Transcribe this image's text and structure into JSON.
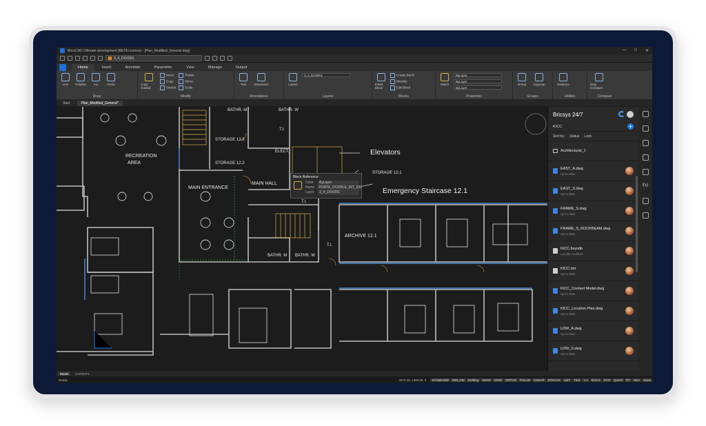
{
  "app": {
    "title": "BricsCAD Ultimate development (BETA License) - [Plan_Modified_General.dwg]",
    "window_controls": [
      "—",
      "□",
      "✕"
    ]
  },
  "quick_access": {
    "layer_value": "3_4_DOORS"
  },
  "ribbon_tabs": [
    "Home",
    "Insert",
    "Annotate",
    "Parametric",
    "View",
    "Manage",
    "Output"
  ],
  "ribbon": {
    "draw": {
      "caption": "Draw",
      "tools": [
        "Line",
        "Polyline",
        "Arc",
        "Circle"
      ]
    },
    "modify": {
      "caption": "Modify",
      "copy_guided": "Copy Guided",
      "items": [
        "Move",
        "Copy",
        "Stretch",
        "Rotate",
        "Mirror",
        "Scale"
      ]
    },
    "annotations": {
      "caption": "Annotations",
      "tools": [
        "Text",
        "Dimension"
      ]
    },
    "layers": {
      "caption": "Layers",
      "layers_button": "Layers",
      "current": "3_4_DOORS"
    },
    "blocks": {
      "caption": "Blocks",
      "insert": "Insert Block",
      "items": [
        "Create Block",
        "Blockify",
        "Edit Block"
      ]
    },
    "properties": {
      "caption": "Properties",
      "match": "Match",
      "values": [
        "ByLayer",
        "ByLayer",
        "ByLayer"
      ]
    },
    "groups": {
      "caption": "Groups",
      "tools": [
        "Group",
        "Ungroup"
      ]
    },
    "utilities": {
      "caption": "Utilities",
      "tools": [
        "Distance"
      ]
    },
    "compare": {
      "caption": "Compare",
      "tools": [
        "Dwg Compare"
      ]
    }
  },
  "doc_tabs": [
    "Start",
    "Plan_Modified_General*"
  ],
  "drawing_labels": {
    "bathr_m_top": "BATHR. M",
    "bathr_w_top": "BATHR. W",
    "storage_123": "STORAGE 12.3",
    "storage_122": "STORAGE 12.2",
    "elect": "ELECT.",
    "ti_1": "T.I.",
    "ti_2": "T.I.",
    "ti_3": "T.I.",
    "recreation": "RECREATION",
    "recreation_2": "AREA",
    "main_entrance": "MAIN ENTRANCE",
    "main_hall": "MAIN HALL",
    "storage_121": "STORAGE 12.1",
    "elevators": "Elevators",
    "emergency": "Emergency Staircase 12.1",
    "archive": "ARCHIVE 12.1",
    "bathr_m_bottom": "BATHR. M",
    "bathr_w_bottom": "BATHR. W"
  },
  "block_reference": {
    "title": "Block Reference",
    "rows": [
      {
        "key": "Color",
        "value": "ByLayer"
      },
      {
        "key": "Name",
        "value": "PORTE_DOUBLE_INT_200"
      },
      {
        "key": "Layer",
        "value": "3_4_DOORS"
      }
    ]
  },
  "bricsys_panel": {
    "title": "Bricsys 24/7",
    "breadcrumb": "KICC",
    "sort_label": "Sort by:",
    "sort_options": [
      "Status",
      "Lock"
    ],
    "items": [
      {
        "name": "Architectural_1",
        "status": "",
        "kind": "folder"
      },
      {
        "name": "EAST_A.dwg",
        "status": "Up-to-date",
        "kind": "dwg"
      },
      {
        "name": "EAST_S.dwg",
        "status": "Up-to-date",
        "kind": "dwg"
      },
      {
        "name": "FRAME_S.dwg",
        "status": "Up-to-date",
        "kind": "dwg"
      },
      {
        "name": "FRAME_S_ROOFBEAM.dwg",
        "status": "Up-to-date",
        "kind": "dwg"
      },
      {
        "name": "KICC.bsysdb",
        "status": "Locally modified",
        "kind": "other"
      },
      {
        "name": "KICC.dst",
        "status": "Up-to-date",
        "kind": "other"
      },
      {
        "name": "KICC_Context Model.dwg",
        "status": "Up-to-date",
        "kind": "dwg"
      },
      {
        "name": "KICC_Location Plan.dwg",
        "status": "Up-to-date",
        "kind": "dwg"
      },
      {
        "name": "LDW_A.dwg",
        "status": "Up-to-date",
        "kind": "dwg"
      },
      {
        "name": "LDW_S.dwg",
        "status": "Up-to-date",
        "kind": "dwg"
      }
    ]
  },
  "layout_tabs": [
    "Model",
    "LAYOUT1"
  ],
  "status": {
    "left": "Ready",
    "coords": "4073.16, 1396.35, 0",
    "flags": [
      "STANDARD",
      "DIM_CM",
      "Drafting",
      "SNAP",
      "GRID",
      "ORTHO",
      "POLAR",
      "ESNAP",
      "STRACK",
      "LWT",
      "TILE",
      "1:1",
      "DUCS",
      "DYN",
      "QUAD",
      "RT",
      "HKA",
      "None"
    ]
  },
  "colors": {
    "accent": "#1e6fd9",
    "screen_bg": "#1e1e1e",
    "bezel": "#0c1a38"
  }
}
